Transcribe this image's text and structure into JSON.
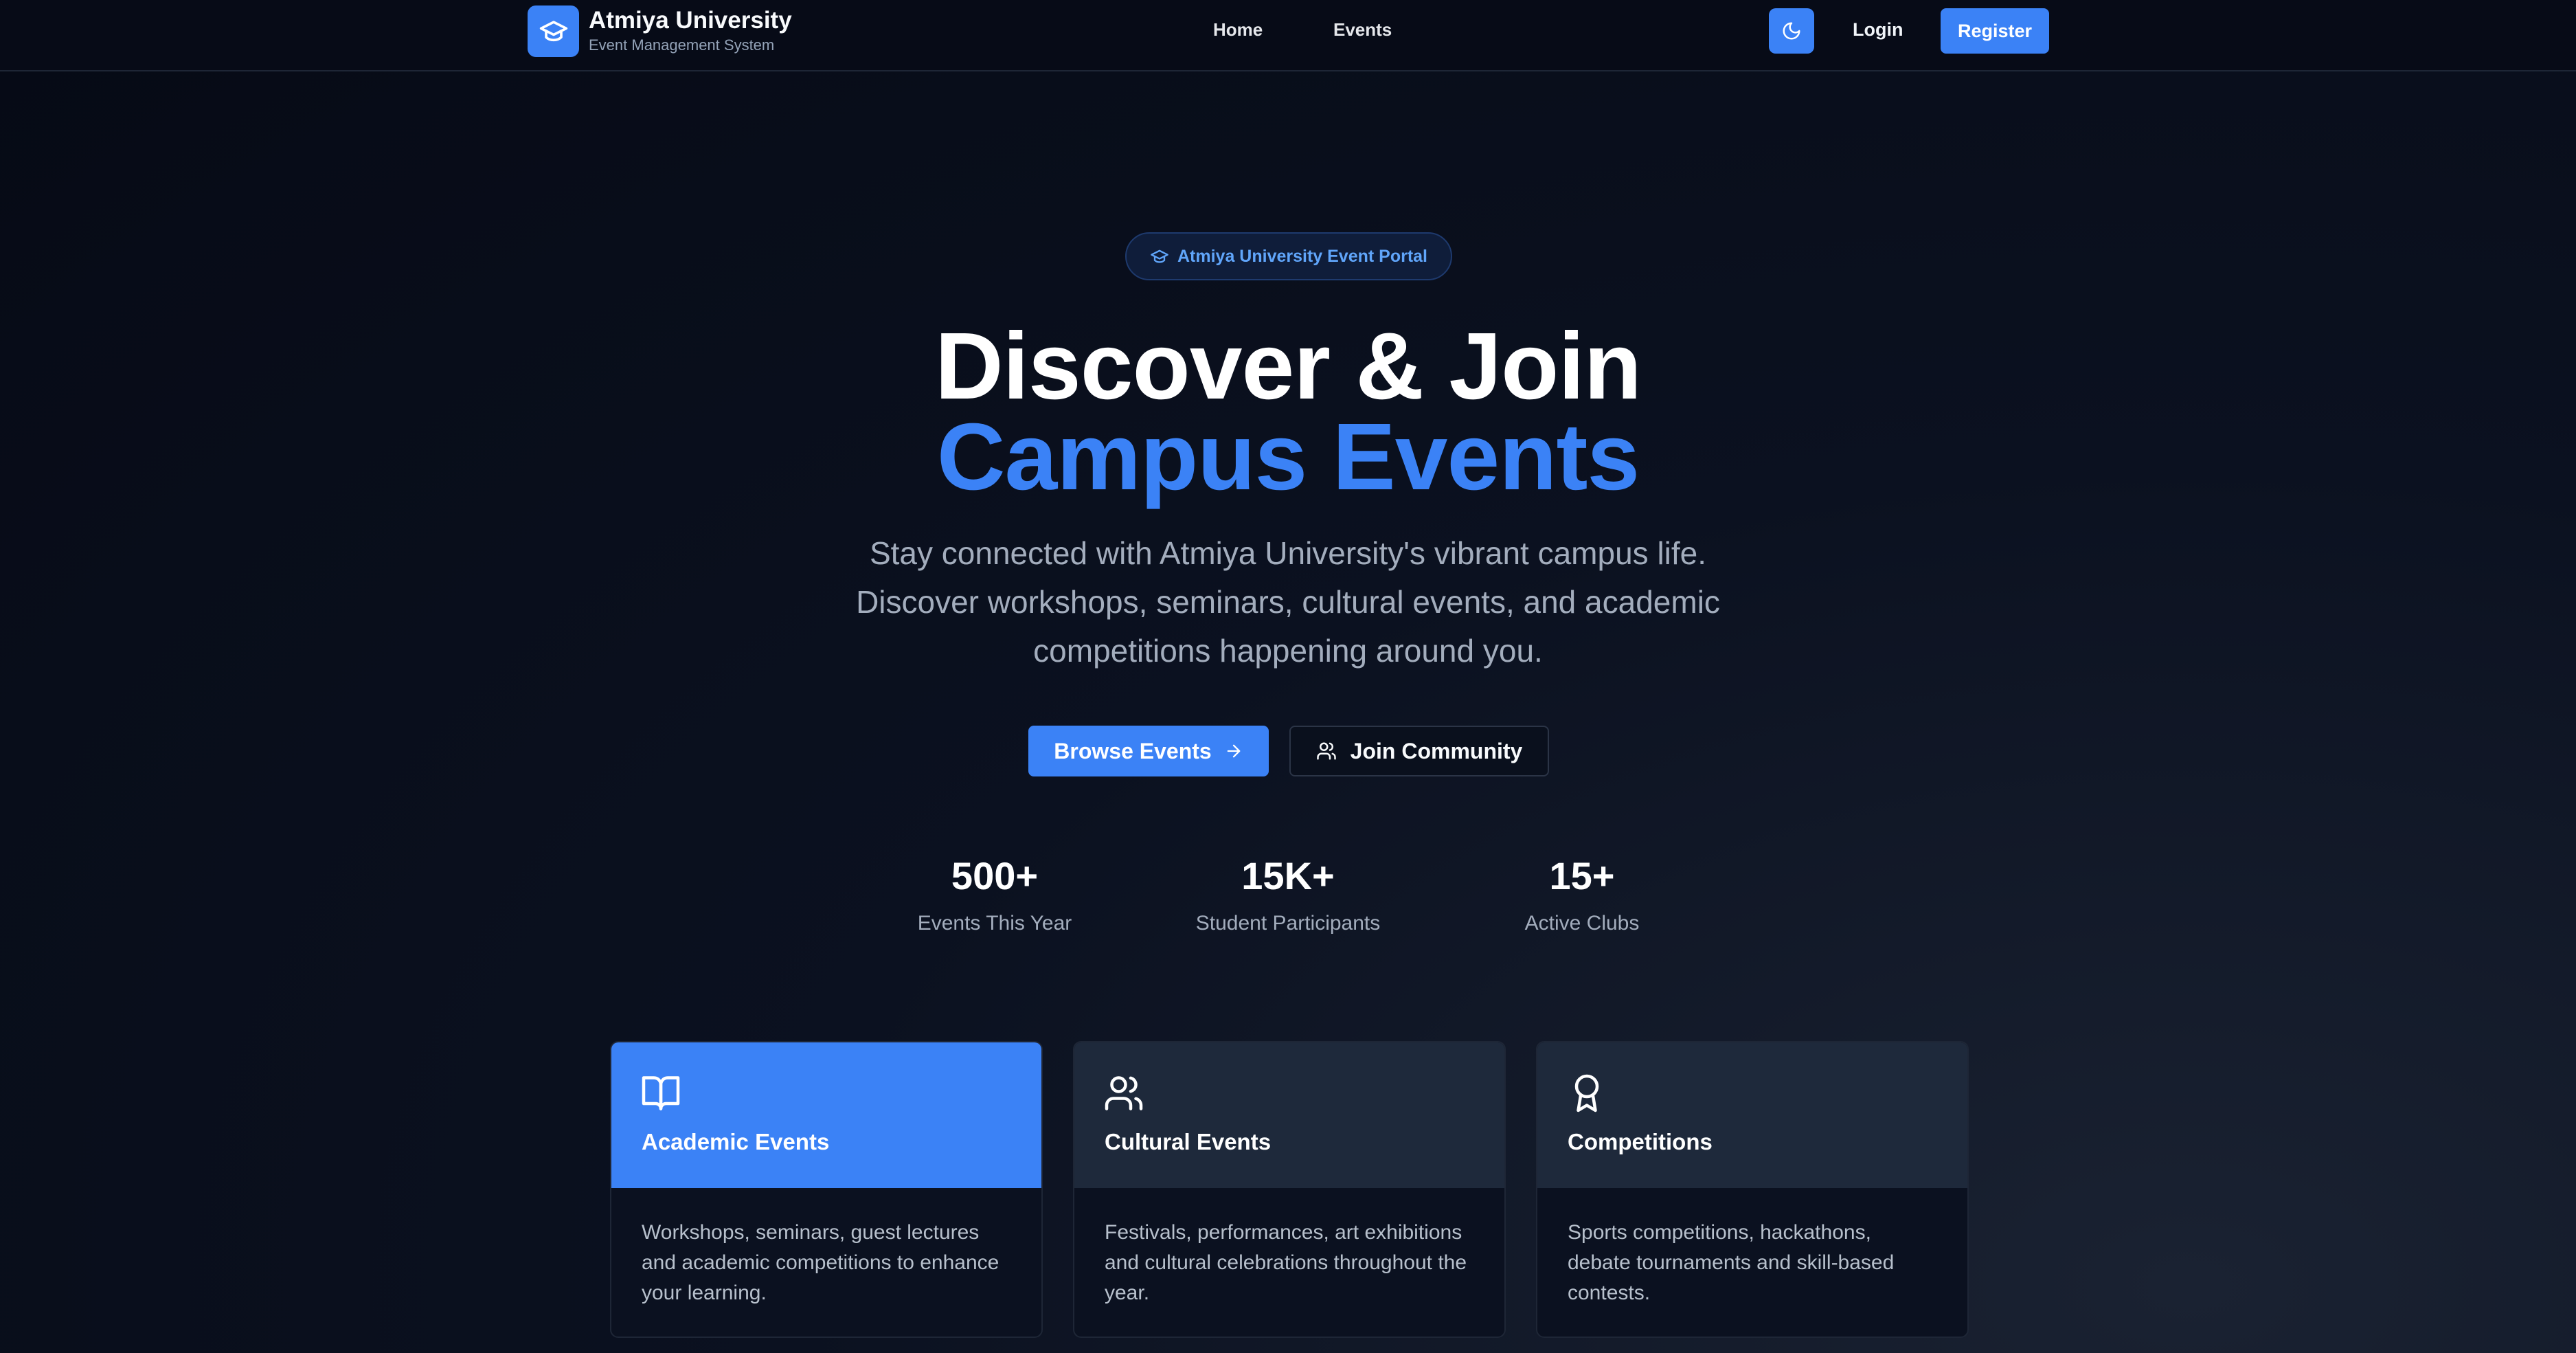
{
  "brand": {
    "title": "Atmiya University",
    "subtitle": "Event Management System",
    "logo_icon": "graduation-cap-icon"
  },
  "nav": {
    "links": [
      "Home",
      "Events"
    ],
    "theme_icon": "moon-icon",
    "login_label": "Login",
    "register_label": "Register"
  },
  "hero": {
    "badge_text": "Atmiya University Event Portal",
    "badge_icon": "graduation-cap-icon",
    "headline_line1": "Discover & Join",
    "headline_line2": "Campus Events",
    "subtitle": "Stay connected with Atmiya University's vibrant campus life. Discover workshops, seminars, cultural events, and academic competitions happening around you.",
    "primary_button": "Browse Events",
    "primary_button_icon": "arrow-right-icon",
    "secondary_button": "Join Community",
    "secondary_button_icon": "users-icon"
  },
  "stats": [
    {
      "value": "500+",
      "label": "Events This Year"
    },
    {
      "value": "15K+",
      "label": "Student Participants"
    },
    {
      "value": "15+",
      "label": "Active Clubs"
    }
  ],
  "cards": [
    {
      "title": "Academic Events",
      "icon": "book-open-icon",
      "description": "Workshops, seminars, guest lectures and academic competitions to enhance your learning.",
      "active": true
    },
    {
      "title": "Cultural Events",
      "icon": "users-icon",
      "description": "Festivals, performances, art exhibitions and cultural celebrations throughout the year.",
      "active": false
    },
    {
      "title": "Competitions",
      "icon": "award-icon",
      "description": "Sports competitions, hackathons, debate tournaments and skill-based contests.",
      "active": false
    }
  ],
  "colors": {
    "accent": "#3b82f6",
    "background": "#070b17",
    "card_header": "#1e293b",
    "muted_text": "#a3adbd"
  }
}
